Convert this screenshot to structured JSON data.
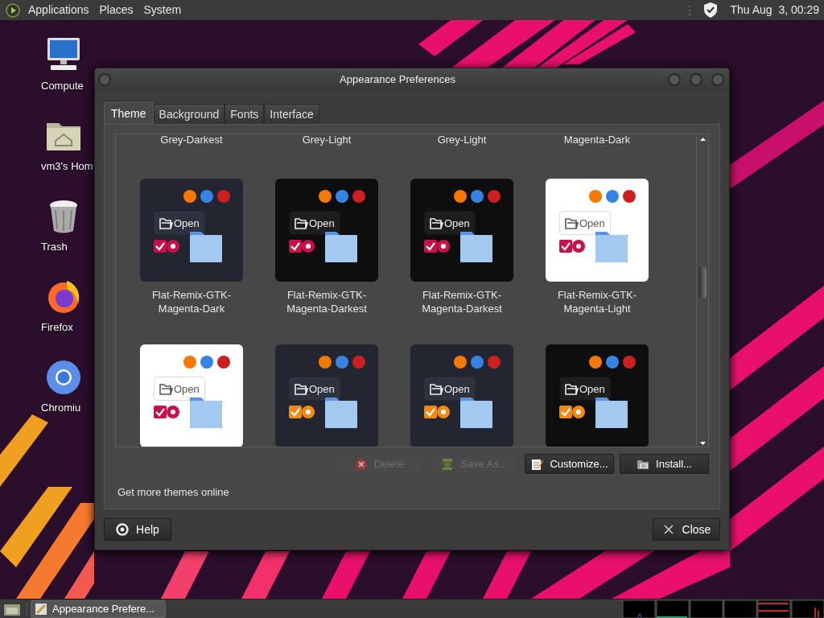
{
  "top_panel": {
    "menus": [
      "Applications",
      "Places",
      "System"
    ],
    "clock": "Thu Aug  3, 00:29"
  },
  "desktop_icons": [
    {
      "label": "Compute",
      "kind": "computer"
    },
    {
      "label": "vm3's Hom",
      "kind": "home"
    },
    {
      "label": "Trash",
      "kind": "trash"
    },
    {
      "label": "Firefox",
      "kind": "firefox"
    },
    {
      "label": "Chromiu",
      "kind": "chromium"
    }
  ],
  "window": {
    "title": "Appearance Preferences"
  },
  "tabs": [
    {
      "label": "Theme",
      "selected": true
    },
    {
      "label": "Background",
      "selected": false
    },
    {
      "label": "Fonts",
      "selected": false
    },
    {
      "label": "Interface",
      "selected": false
    }
  ],
  "partial_row_labels": [
    "Grey-Darkest",
    "Grey-Light",
    "Grey-Light",
    "Magenta-Dark"
  ],
  "themes": [
    {
      "name": "Flat-Remix-GTK-Magenta-Dark",
      "kind": "dark",
      "color": "#c8104a",
      "preview_button": "Open"
    },
    {
      "name": "Flat-Remix-GTK-Magenta-Darkest",
      "kind": "darkest",
      "color": "#c8104a",
      "preview_button": "Open"
    },
    {
      "name": "Flat-Remix-GTK-Magenta-Darkest",
      "kind": "darkest",
      "color": "#c8104a",
      "preview_button": "Open"
    },
    {
      "name": "Flat-Remix-GTK-Magenta-Light",
      "kind": "light",
      "color": "#c8104a",
      "preview_button": "Open"
    },
    {
      "kind": "light",
      "color": "#c8104a",
      "preview_button": "Open"
    },
    {
      "kind": "dark",
      "color": "#f08a12",
      "preview_button": "Open"
    },
    {
      "kind": "dark",
      "color": "#f08a12",
      "preview_button": "Open"
    },
    {
      "kind": "darkest",
      "color": "#f08a12",
      "preview_button": "Open"
    }
  ],
  "actions": [
    {
      "label": "Delete",
      "kind": "delete",
      "disabled": true
    },
    {
      "label": "Save As...",
      "kind": "save",
      "disabled": true
    },
    {
      "label": "Customize...",
      "kind": "customize",
      "disabled": false
    },
    {
      "label": "Install...",
      "kind": "install",
      "disabled": false
    }
  ],
  "link": "Get more themes online",
  "footer_buttons": [
    {
      "label": "Help",
      "kind": "help"
    },
    {
      "label": "Close",
      "kind": "close"
    }
  ],
  "taskbar": {
    "task": "Appearance Prefere..."
  }
}
